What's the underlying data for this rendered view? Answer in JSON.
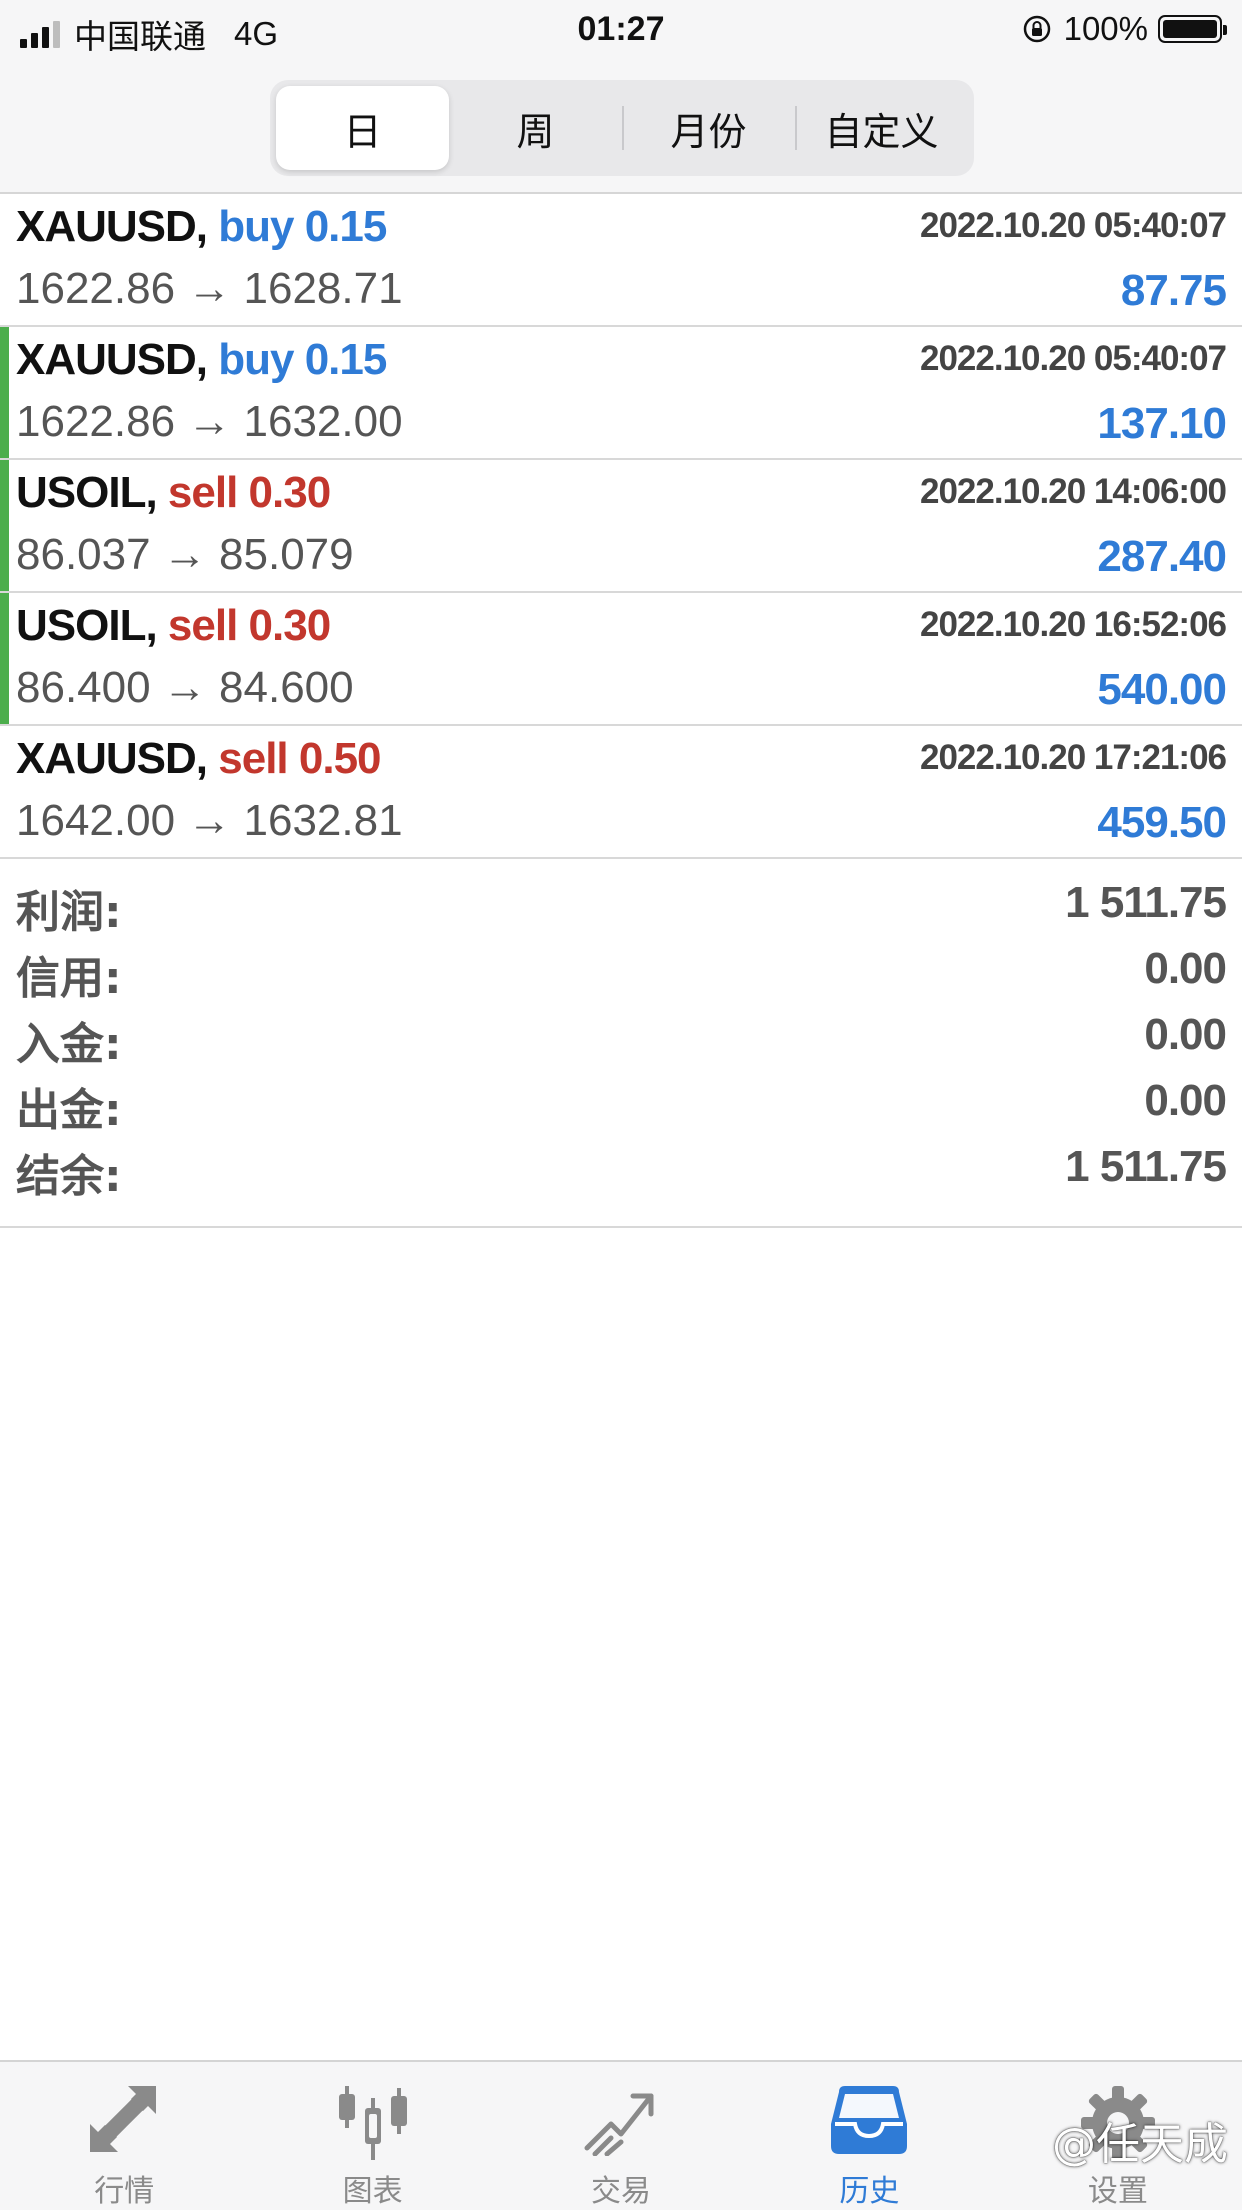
{
  "status_bar": {
    "carrier": "中国联通",
    "network": "4G",
    "time": "01:27",
    "battery": "100%"
  },
  "segments": [
    {
      "label": "日",
      "active": true
    },
    {
      "label": "周",
      "active": false
    },
    {
      "label": "月份",
      "active": false
    },
    {
      "label": "自定义",
      "active": false
    }
  ],
  "trades": [
    {
      "symbol": "XAUUSD,",
      "side": "buy 0.15",
      "time": "2022.10.20 05:40:07",
      "prices": "1622.86 → 1628.71",
      "profit": "87.75"
    },
    {
      "symbol": "XAUUSD,",
      "side": "buy 0.15",
      "time": "2022.10.20 05:40:07",
      "prices": "1622.86 → 1632.00",
      "profit": "137.10"
    },
    {
      "symbol": "USOIL,",
      "side": "sell 0.30",
      "time": "2022.10.20 14:06:00",
      "prices": "86.037 → 85.079",
      "profit": "287.40"
    },
    {
      "symbol": "USOIL,",
      "side": "sell 0.30",
      "time": "2022.10.20 16:52:06",
      "prices": "86.400 → 84.600",
      "profit": "540.00"
    },
    {
      "symbol": "XAUUSD,",
      "side": "sell 0.50",
      "time": "2022.10.20 17:21:06",
      "prices": "1642.00 → 1632.81",
      "profit": "459.50"
    }
  ],
  "summary": [
    {
      "label": "利润:",
      "value": "1 511.75"
    },
    {
      "label": "信用:",
      "value": "0.00"
    },
    {
      "label": "入金:",
      "value": "0.00"
    },
    {
      "label": "出金:",
      "value": "0.00"
    },
    {
      "label": "结余:",
      "value": "1 511.75"
    }
  ],
  "tabbar": [
    {
      "label": "行情",
      "icon": "quotes-arrows-icon",
      "active": false
    },
    {
      "label": "图表",
      "icon": "candlestick-chart-icon",
      "active": false
    },
    {
      "label": "交易",
      "icon": "trade-trend-icon",
      "active": false
    },
    {
      "label": "历史",
      "icon": "history-inbox-icon",
      "active": true
    },
    {
      "label": "设置",
      "icon": "gear-icon",
      "active": false
    }
  ],
  "watermark": "@任天成",
  "colors": {
    "buy": "#2f7bd6",
    "sell": "#c2372d",
    "profit": "#2f7bd6",
    "marker": "#4cae4c",
    "active_tab": "#2f7bd6"
  }
}
